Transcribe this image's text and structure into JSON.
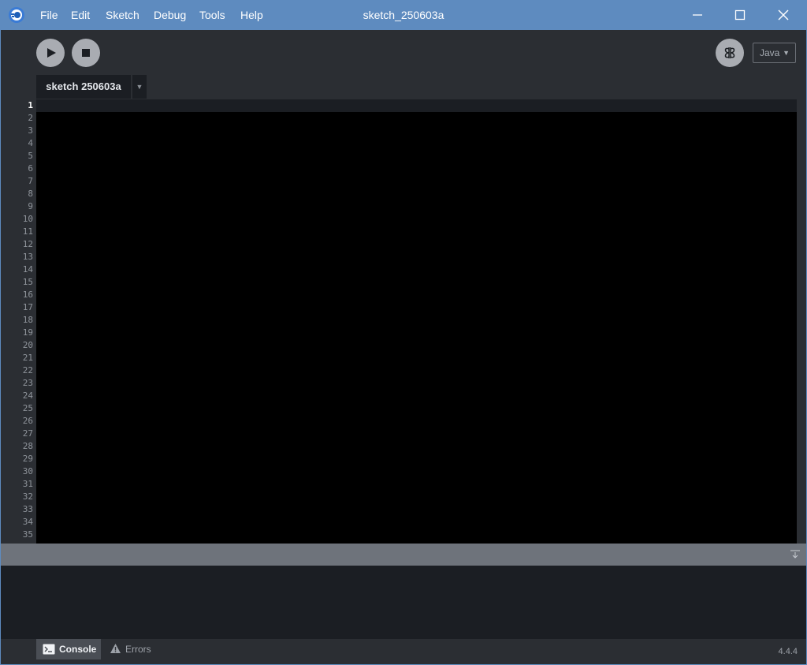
{
  "window": {
    "title": "sketch_250603a",
    "menu": [
      "File",
      "Edit",
      "Sketch",
      "Debug",
      "Tools",
      "Help"
    ],
    "controls": [
      "minimize-icon",
      "maximize-icon",
      "close-icon"
    ]
  },
  "toolbar": {
    "run_icon": "play-icon",
    "stop_icon": "stop-icon",
    "debugger_icon": "butterfly-icon",
    "mode": "Java"
  },
  "tabs": {
    "active": "sketch 250603a",
    "menu_icon": "chevron-down-icon"
  },
  "editor": {
    "line_numbers": [
      "1",
      "2",
      "3",
      "4",
      "5",
      "6",
      "7",
      "8",
      "9",
      "10",
      "11",
      "12",
      "13",
      "14",
      "15",
      "16",
      "17",
      "18",
      "19",
      "20",
      "21",
      "22",
      "23",
      "24",
      "25",
      "26",
      "27",
      "28",
      "29",
      "30",
      "31",
      "32",
      "33",
      "34",
      "35"
    ],
    "current_line": "1"
  },
  "footer": {
    "console_label": "Console",
    "errors_label": "Errors",
    "version": "4.4.4"
  },
  "colors": {
    "titlebar": "#5e8bbf",
    "background": "#2b2e33",
    "editor": "#000000",
    "console": "#1b1e23",
    "console_header": "#6e737b"
  }
}
